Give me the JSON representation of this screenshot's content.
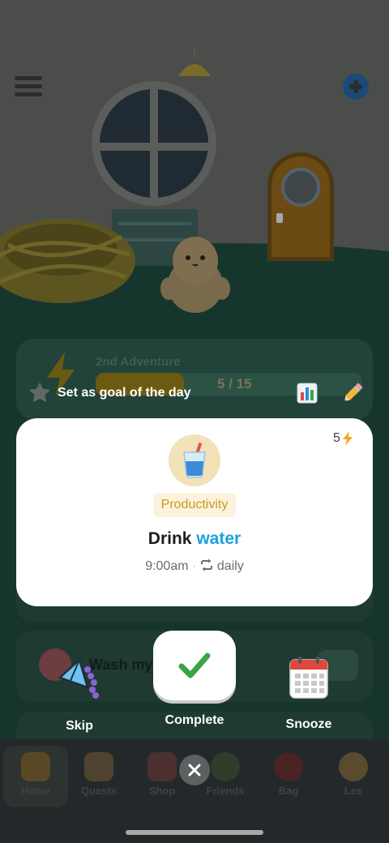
{
  "adventure": {
    "title": "2nd Adventure",
    "progress_text": "5 / 15",
    "progress_value": 5,
    "progress_total": 15
  },
  "goal": {
    "label": "Set as goal of the day",
    "star_icon": "star-icon",
    "stats_icon": "bar-chart-icon",
    "edit_icon": "pencil-icon"
  },
  "task": {
    "energy": "5",
    "emoji_icon": "water-glass-icon",
    "category": "Productivity",
    "title_prefix": "Drink",
    "title_highlight": "water",
    "time": "9:00am",
    "separator": "·",
    "repeat": "daily"
  },
  "background_task": {
    "title": "Wash my"
  },
  "actions": {
    "skip": "Skip",
    "complete": "Complete",
    "snooze": "Snooze"
  },
  "nav": {
    "items": [
      {
        "label": "Home"
      },
      {
        "label": "Quests"
      },
      {
        "label": "Shop"
      },
      {
        "label": "Friends"
      },
      {
        "label": "Bag"
      },
      {
        "label": "Lee"
      }
    ]
  },
  "colors": {
    "accent_blue": "#1aa0e0",
    "category_gold": "#c99a1f",
    "check_green": "#3aa547"
  }
}
